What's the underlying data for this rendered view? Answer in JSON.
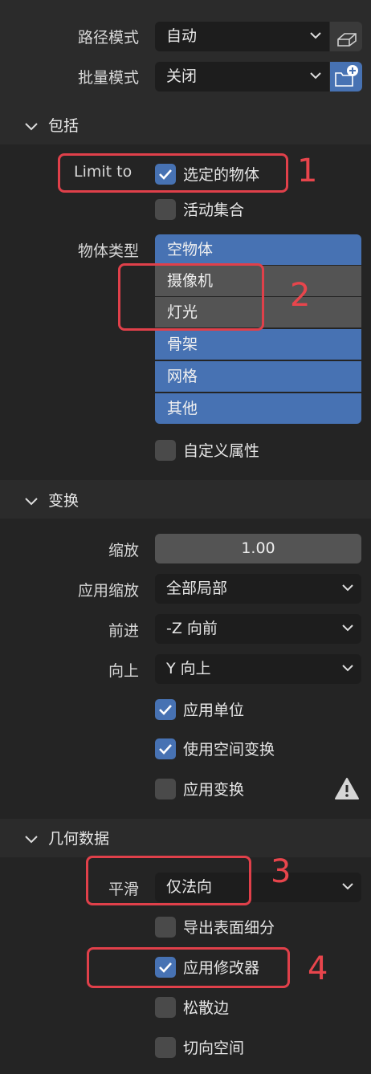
{
  "path_mode": {
    "label": "路径模式",
    "value": "自动",
    "icon": "box-icon"
  },
  "batch_mode": {
    "label": "批量模式",
    "value": "关闭",
    "icon": "new-folder-icon"
  },
  "include": {
    "title": "包括",
    "limit_label": "Limit to",
    "selected_objects": {
      "label": "选定的物体",
      "checked": true
    },
    "active_collection": {
      "label": "活动集合",
      "checked": false
    },
    "object_types_label": "物体类型",
    "object_types": [
      {
        "label": "空物体",
        "selected": true
      },
      {
        "label": "摄像机",
        "selected": false
      },
      {
        "label": "灯光",
        "selected": false
      },
      {
        "label": "骨架",
        "selected": true
      },
      {
        "label": "网格",
        "selected": true
      },
      {
        "label": "其他",
        "selected": true
      }
    ],
    "custom_props": {
      "label": "自定义属性",
      "checked": false
    }
  },
  "transform": {
    "title": "变换",
    "scale_label": "缩放",
    "scale_value": "1.00",
    "apply_scaling_label": "应用缩放",
    "apply_scaling_value": "全部局部",
    "forward_label": "前进",
    "forward_value": "-Z 向前",
    "up_label": "向上",
    "up_value": "Y 向上",
    "apply_unit": {
      "label": "应用单位",
      "checked": true
    },
    "use_space_transform": {
      "label": "使用空间变换",
      "checked": true
    },
    "apply_transform": {
      "label": "应用变换",
      "checked": false
    },
    "warning_icon": "warning-icon"
  },
  "geometry": {
    "title": "几何数据",
    "smoothing_label": "平滑",
    "smoothing_value": "仅法向",
    "export_subdiv": {
      "label": "导出表面细分",
      "checked": false
    },
    "apply_modifiers": {
      "label": "应用修改器",
      "checked": true
    },
    "loose_edges": {
      "label": "松散边",
      "checked": false
    },
    "tangent_space": {
      "label": "切向空间",
      "checked": false
    }
  },
  "annotations": [
    "1",
    "2",
    "3",
    "4"
  ],
  "colors": {
    "accent": "#4772b3",
    "annotation": "#e0404a"
  }
}
